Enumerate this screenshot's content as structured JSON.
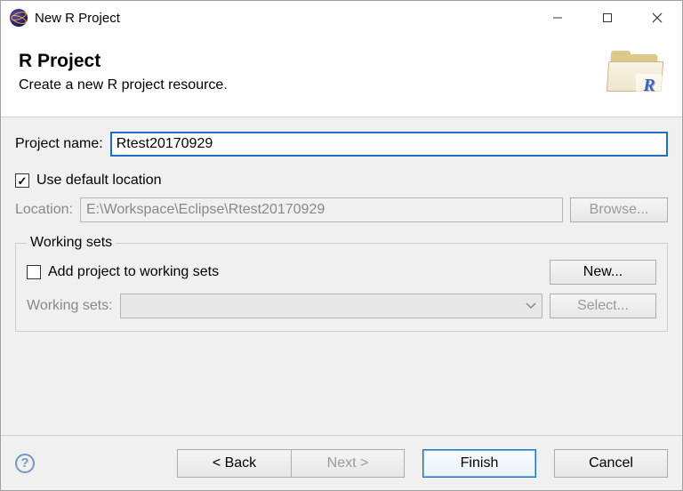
{
  "titlebar": {
    "title": "New R Project"
  },
  "header": {
    "title": "R Project",
    "description": "Create a new R project resource."
  },
  "form": {
    "project_name_label": "Project name:",
    "project_name_value": "Rtest20170929",
    "use_default_location_label": "Use default location",
    "use_default_location_checked": true,
    "location_label": "Location:",
    "location_value": "E:\\Workspace\\Eclipse\\Rtest20170929",
    "browse_label": "Browse..."
  },
  "working_sets": {
    "legend": "Working sets",
    "add_label": "Add project to working sets",
    "add_checked": false,
    "new_label": "New...",
    "combo_label": "Working sets:",
    "select_label": "Select..."
  },
  "footer": {
    "back": "< Back",
    "next": "Next >",
    "finish": "Finish",
    "cancel": "Cancel"
  }
}
